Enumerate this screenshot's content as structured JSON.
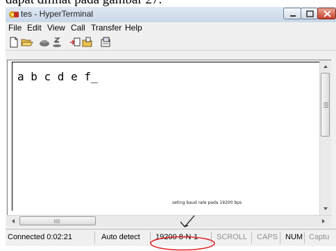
{
  "document": {
    "caption": "dapat dilihat pada gambar 27."
  },
  "window": {
    "title": "tes - HyperTerminal",
    "app_icon": "hyperterminal-icon"
  },
  "menu": {
    "items": [
      "File",
      "Edit",
      "View",
      "Call",
      "Transfer",
      "Help"
    ]
  },
  "toolbar": {
    "icons": [
      "new-file-icon",
      "open-folder-icon",
      "phone-icon",
      "disconnect-icon",
      "send-icon",
      "receive-icon",
      "properties-icon"
    ]
  },
  "terminal": {
    "text": "a b c d e f_"
  },
  "annotation": {
    "text": "seting baud rate pada 19200 bps"
  },
  "status": {
    "connected": "Connected 0:02:21",
    "detect": "Auto detect",
    "settings": "19200 8-N-1",
    "scroll": "SCROLL",
    "caps": "CAPS",
    "num": "NUM",
    "capture": "Captu"
  },
  "colors": {
    "highlight_ellipse": "#e02020",
    "close_button": "#c5402a"
  }
}
